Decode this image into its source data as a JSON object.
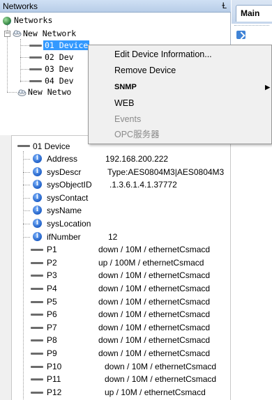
{
  "networks_panel": {
    "title": "Networks",
    "pin": "Ɫ",
    "tree": {
      "root": "Networks",
      "network1": "New Network",
      "devices": [
        "01 Device",
        "02 Dev",
        "03 Dev",
        "04 Dev"
      ],
      "network2": "New Netwo"
    }
  },
  "tab_area": {
    "main_tab": "Main"
  },
  "context_menu": {
    "items": [
      {
        "label": "Edit Device Information...",
        "enabled": true
      },
      {
        "label": "Remove Device",
        "enabled": true
      },
      {
        "label": "SNMP",
        "enabled": true,
        "submenu": true
      },
      {
        "label": "WEB",
        "enabled": true
      },
      {
        "label": "Events",
        "enabled": false
      },
      {
        "label": "OPC服务器",
        "enabled": false
      }
    ],
    "submenu_arrow": "▶"
  },
  "properties": {
    "device": "01 Device",
    "info": [
      {
        "name": "Address",
        "value": "192.168.200.222"
      },
      {
        "name": "sysDescr",
        "value": "Type:AES0804M3|AES0804M3"
      },
      {
        "name": "sysObjectID",
        "value": ".1.3.6.1.4.1.37772"
      },
      {
        "name": "sysContact",
        "value": ""
      },
      {
        "name": "sysName",
        "value": ""
      },
      {
        "name": "sysLocation",
        "value": ""
      },
      {
        "name": "ifNumber",
        "value": "12"
      }
    ],
    "ports": [
      {
        "name": "P1",
        "value": "down / 10M / ethernetCsmacd"
      },
      {
        "name": "P2",
        "value": "up / 100M / ethernetCsmacd"
      },
      {
        "name": "P3",
        "value": "down / 10M / ethernetCsmacd"
      },
      {
        "name": "P4",
        "value": "down / 10M / ethernetCsmacd"
      },
      {
        "name": "P5",
        "value": "down / 10M / ethernetCsmacd"
      },
      {
        "name": "P6",
        "value": "down / 10M / ethernetCsmacd"
      },
      {
        "name": "P7",
        "value": "down / 10M / ethernetCsmacd"
      },
      {
        "name": "P8",
        "value": "down / 10M / ethernetCsmacd"
      },
      {
        "name": "P9",
        "value": "down / 10M / ethernetCsmacd"
      },
      {
        "name": "P10",
        "value": "down / 10M / ethernetCsmacd"
      },
      {
        "name": "P11",
        "value": "down / 10M / ethernetCsmacd"
      },
      {
        "name": "P12",
        "value": "up / 10M / ethernetCsmacd"
      }
    ]
  },
  "colors": {
    "selection": "#3399ff",
    "header": "#b8cde8",
    "menu_bg": "#f0f0f0",
    "disabled_text": "#8a8a8a"
  }
}
